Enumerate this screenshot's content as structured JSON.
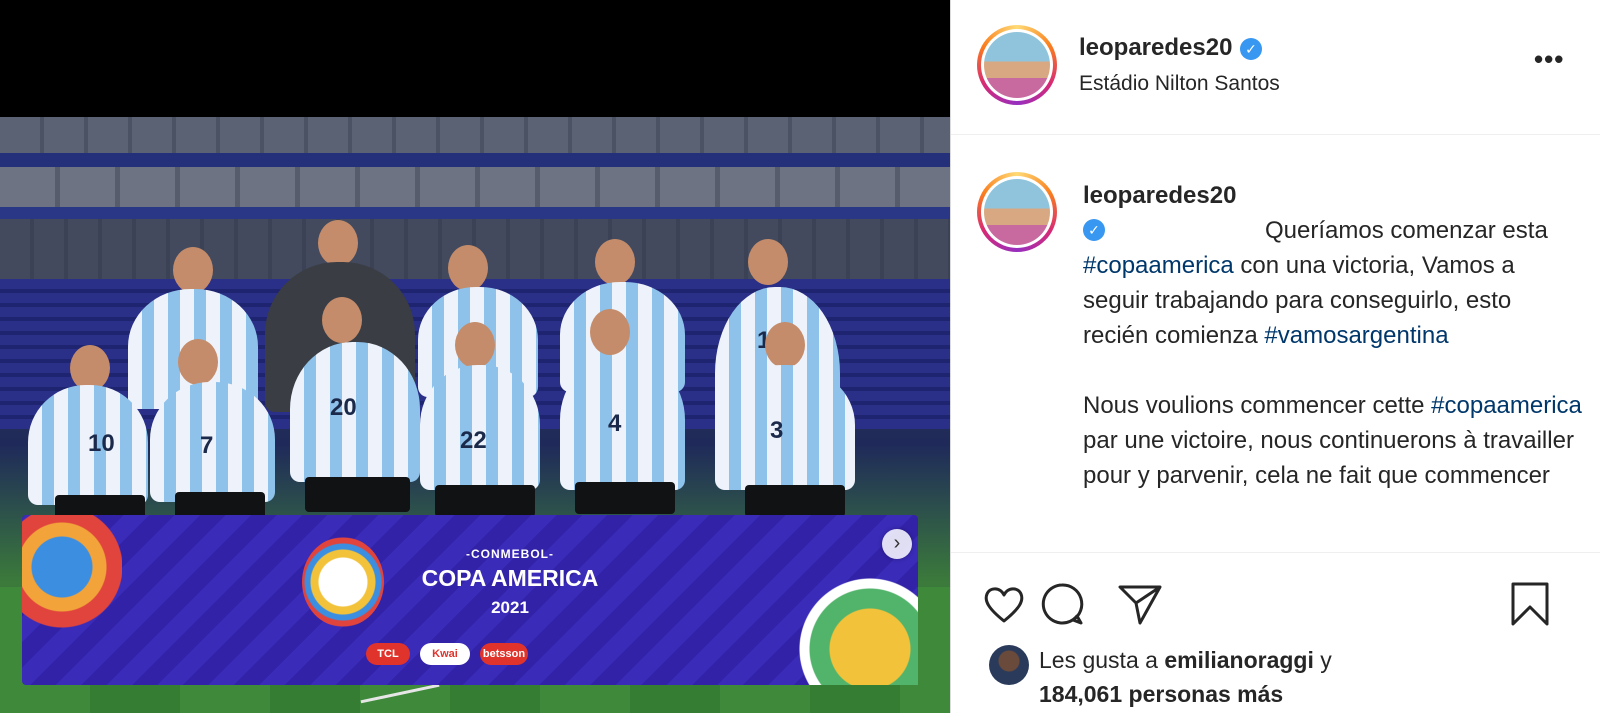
{
  "post": {
    "username": "leoparedes20",
    "location": "Estádio Nilton Santos",
    "more_label": "•••"
  },
  "media": {
    "board": {
      "subtitle": "-CONMEBOL-",
      "title": "COPA AMERICA",
      "year": "2021",
      "sponsors": [
        "TCL",
        "Kwai",
        "betsson"
      ]
    },
    "jersey_numbers": [
      "10",
      "7",
      "20",
      "22",
      "4",
      "3",
      "19"
    ],
    "next_icon": "chevron-right-icon"
  },
  "caption": {
    "username": "leoparedes20",
    "para1": {
      "t1": "Queríamos comenzar esta ",
      "tag1": "#copaamerica",
      "t2": " con una victoria, Vamos a seguir trabajando para conseguirlo, esto recién comienza ",
      "tag2": "#vamosargentina"
    },
    "para2": {
      "t1": "Nous voulions commencer cette ",
      "tag1": "#copaamerica",
      "t2": " par une victoire, nous continuerons à travailler pour y parvenir, cela ne fait que commencer"
    }
  },
  "actions": {
    "icons": [
      "heart-icon",
      "comment-icon",
      "share-icon",
      "bookmark-icon"
    ]
  },
  "likes": {
    "prefix": "Les gusta a ",
    "user": "emilianoraggi",
    "and": " y",
    "count_line": "184,061 personas más"
  },
  "colors": {
    "verified": "#3897f0",
    "hashtag": "#00376b",
    "border": "#dbdbdb"
  }
}
